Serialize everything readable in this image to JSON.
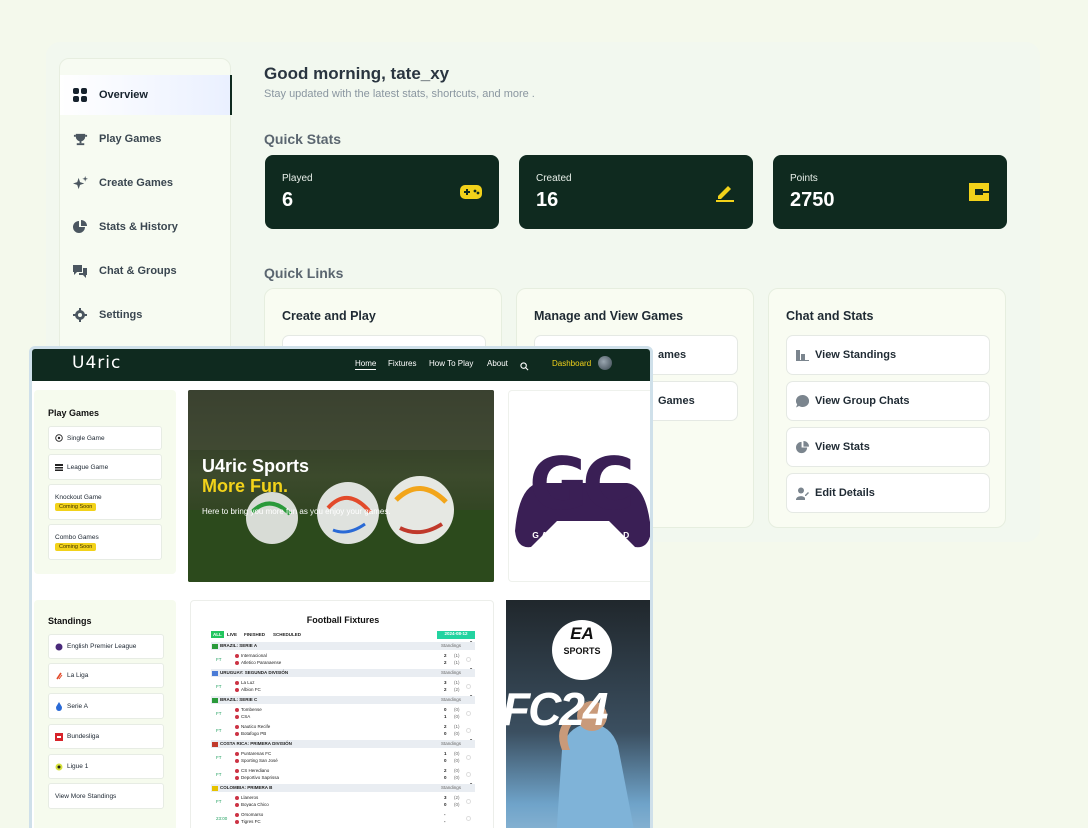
{
  "greeting": "Good morning, tate_xy",
  "greeting_sub": "Stay updated with the latest stats, shortcuts, and more .",
  "sidebar": {
    "items": [
      {
        "label": "Overview",
        "icon": "grid-icon"
      },
      {
        "label": "Play Games",
        "icon": "trophy-icon"
      },
      {
        "label": "Create Games",
        "icon": "sparkles-icon"
      },
      {
        "label": "Stats & History",
        "icon": "pie-chart-icon"
      },
      {
        "label": "Chat & Groups",
        "icon": "chat-icon"
      },
      {
        "label": "Settings",
        "icon": "gear-icon"
      }
    ]
  },
  "quick_stats": {
    "title": "Quick Stats",
    "cards": [
      {
        "label": "Played",
        "value": "6",
        "icon": "gamepad-icon"
      },
      {
        "label": "Created",
        "value": "16",
        "icon": "pencil-icon"
      },
      {
        "label": "Points",
        "value": "2750",
        "icon": "points-icon"
      }
    ]
  },
  "quick_links": {
    "title": "Quick Links",
    "cards": [
      {
        "title": "Create and Play",
        "links": []
      },
      {
        "title": "Manage and View Games",
        "links": [
          "ames",
          "Games"
        ]
      },
      {
        "title": "Chat and Stats",
        "links": [
          "View Standings",
          "View Group Chats",
          "View Stats",
          "Edit Details"
        ]
      }
    ]
  },
  "site": {
    "logo": "U4ric",
    "nav": [
      "Home",
      "Fixtures",
      "How To Play",
      "About"
    ],
    "dashboard": "Dashboard",
    "play_games": {
      "title": "Play Games",
      "items": [
        "Single Game",
        "League Game",
        "Knockout Game",
        "Combo Games"
      ],
      "coming_soon": "Coming Soon"
    },
    "hero": {
      "title1": "U4ric Sports",
      "title2": "More Fun.",
      "subtitle": "Here to bring you more fun as you enjoy your games."
    },
    "gc": {
      "letters": "GC",
      "text": "GAMERS CREED"
    },
    "ea": {
      "brand": "EA",
      "sports": "SPORTS",
      "title": "FC24"
    },
    "standings": {
      "title": "Standings",
      "items": [
        "English Premier League",
        "La Liga",
        "Serie A",
        "Bundesliga",
        "Ligue 1",
        "View More Standings"
      ]
    },
    "fixtures": {
      "title": "Football Fixtures",
      "tabs": [
        "ALL",
        "LIVE",
        "FINISHED",
        "SCHEDULED"
      ],
      "date": "2024-08-12",
      "standings_label": "Standings",
      "leagues": [
        {
          "name": "BRAZIL: SERIE A",
          "flag": "#2a9a3a",
          "matches": [
            {
              "time": "FT",
              "home": "Internacional",
              "away": "Atletico Paranaense",
              "hs": "2",
              "as": "2",
              "hh": "(1)",
              "ah": "(1)"
            }
          ]
        },
        {
          "name": "URUGUAY: SEGUNDA DIVISIÓN",
          "flag": "#4a7bd6",
          "matches": [
            {
              "time": "FT",
              "home": "La Luz",
              "away": "Albion FC",
              "hs": "3",
              "as": "2",
              "hh": "(1)",
              "ah": "(2)"
            }
          ]
        },
        {
          "name": "BRAZIL: SERIE C",
          "flag": "#2a9a3a",
          "matches": [
            {
              "time": "FT",
              "home": "Tombense",
              "away": "CSA",
              "hs": "0",
              "as": "1",
              "hh": "(0)",
              "ah": "(0)"
            },
            {
              "time": "FT",
              "home": "Nautico Recife",
              "away": "Botafogo PB",
              "hs": "2",
              "as": "0",
              "hh": "(1)",
              "ah": "(0)"
            }
          ]
        },
        {
          "name": "COSTA RICA: PRIMERA DIVISIÓN",
          "flag": "#c0392b",
          "matches": [
            {
              "time": "FT",
              "home": "Puntarenas FC",
              "away": "Sporting San José",
              "hs": "1",
              "as": "0",
              "hh": "(0)",
              "ah": "(0)"
            },
            {
              "time": "FT",
              "home": "CS Herediano",
              "away": "Deportivo Saprissa",
              "hs": "2",
              "as": "0",
              "hh": "(0)",
              "ah": "(0)"
            }
          ]
        },
        {
          "name": "COLOMBIA: PRIMERA B",
          "flag": "#e6c200",
          "matches": [
            {
              "time": "FT",
              "home": "Llaneros",
              "away": "Boyaca Chico",
              "hs": "3",
              "as": "0",
              "hh": "(2)",
              "ah": "(0)"
            },
            {
              "time": "23:00",
              "home": "Orsomarso",
              "away": "Tigres FC",
              "hs": "-",
              "as": "-",
              "hh": "",
              "ah": ""
            }
          ]
        }
      ]
    }
  },
  "colors": {
    "dark_green": "#0f2a1f",
    "accent_yellow": "#f2d21a",
    "bg": "#f4f9ec"
  }
}
